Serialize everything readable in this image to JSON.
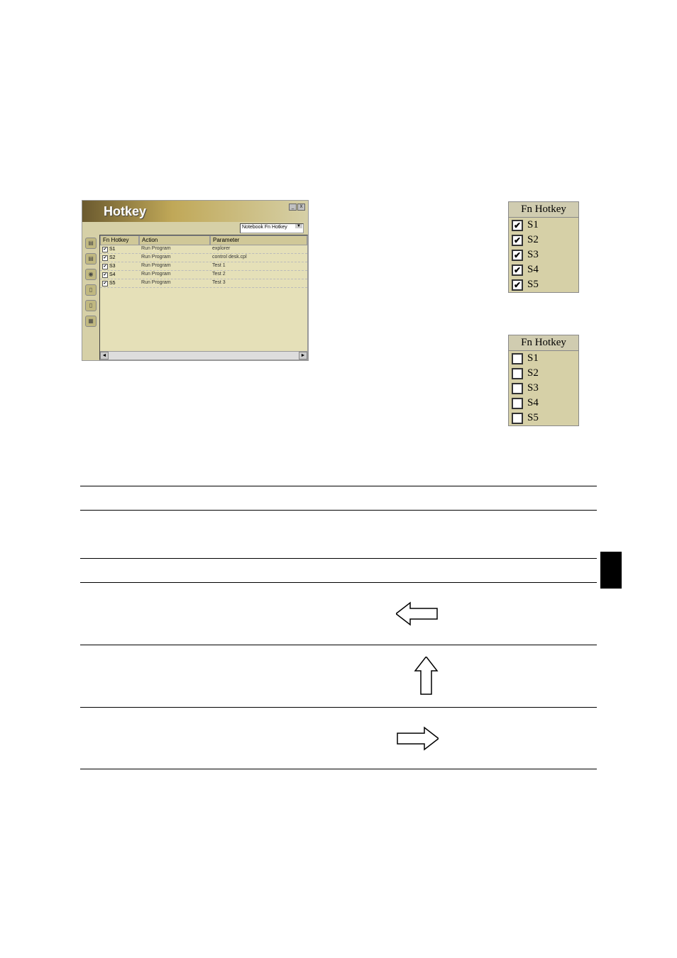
{
  "window": {
    "title": "Hotkey",
    "dropdown_label": "Notebook Fn Hotkey",
    "columns": {
      "fn": "Fn Hotkey",
      "action": "Action",
      "parameter": "Parameter"
    },
    "rows": [
      {
        "checked": true,
        "fn": "S1",
        "action": "Run Program",
        "parameter": "explorer"
      },
      {
        "checked": true,
        "fn": "S2",
        "action": "Run Program",
        "parameter": "control desk.cpl"
      },
      {
        "checked": true,
        "fn": "S3",
        "action": "Run Program",
        "parameter": "Test 1"
      },
      {
        "checked": true,
        "fn": "S4",
        "action": "Run Program",
        "parameter": "Test 2"
      },
      {
        "checked": true,
        "fn": "S5",
        "action": "Run Program",
        "parameter": "Test 3"
      }
    ],
    "titlebar_buttons": {
      "min": "_",
      "close": "X"
    }
  },
  "fn_panel_checked": {
    "header": "Fn Hotkey",
    "items": [
      {
        "label": "S1",
        "checked": true
      },
      {
        "label": "S2",
        "checked": true
      },
      {
        "label": "S3",
        "checked": true
      },
      {
        "label": "S4",
        "checked": true
      },
      {
        "label": "S5",
        "checked": true
      }
    ]
  },
  "fn_panel_unchecked": {
    "header": "Fn Hotkey",
    "items": [
      {
        "label": "S1",
        "checked": false
      },
      {
        "label": "S2",
        "checked": false
      },
      {
        "label": "S3",
        "checked": false
      },
      {
        "label": "S4",
        "checked": false
      },
      {
        "label": "S5",
        "checked": false
      }
    ]
  },
  "checkmark": "✔",
  "icons": {
    "scroll_left": "◄",
    "scroll_right": "►"
  }
}
